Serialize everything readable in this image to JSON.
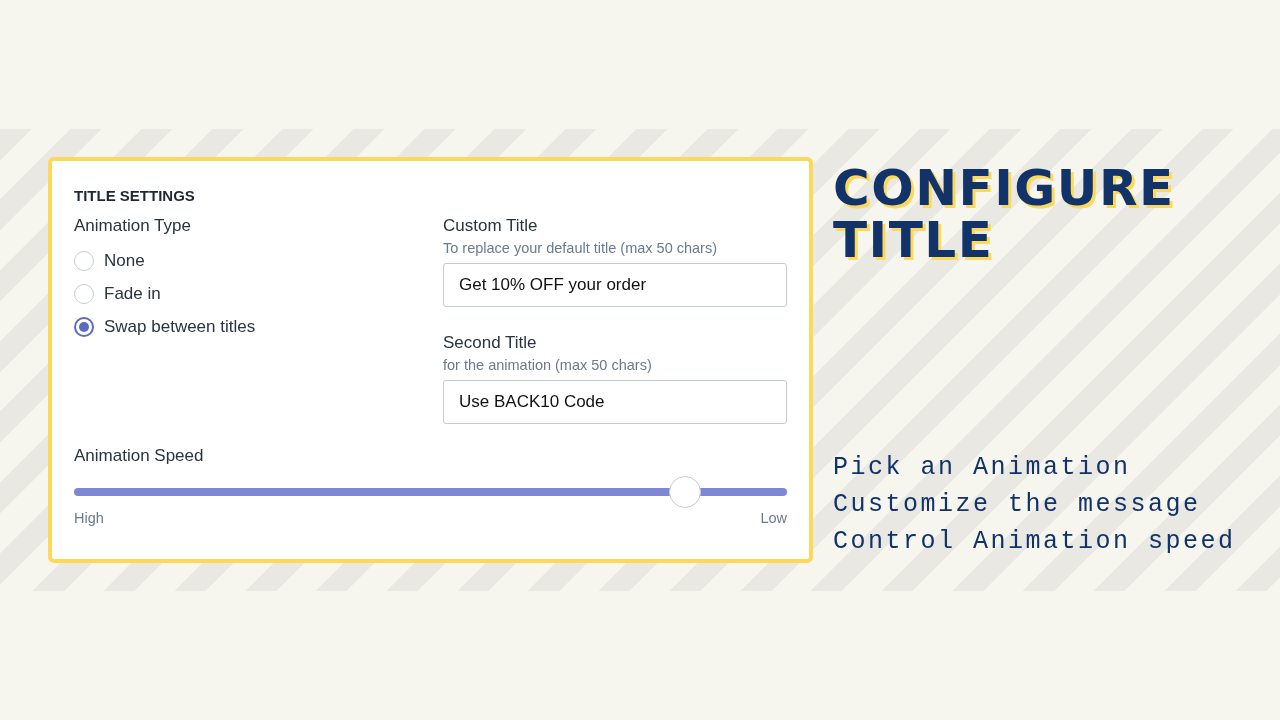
{
  "panel": {
    "heading": "TITLE SETTINGS",
    "animation_type": {
      "label": "Animation Type",
      "options": [
        {
          "label": "None",
          "selected": false
        },
        {
          "label": "Fade in",
          "selected": false
        },
        {
          "label": "Swap between titles",
          "selected": true
        }
      ]
    },
    "custom_title": {
      "label": "Custom Title",
      "hint": "To replace your default title (max 50 chars)",
      "value": "Get 10% OFF your order"
    },
    "second_title": {
      "label": "Second Title",
      "hint": "for the animation (max 50 chars)",
      "value": "Use BACK10 Code"
    },
    "animation_speed": {
      "label": "Animation Speed",
      "level": 0.857,
      "min_label": "High",
      "max_label": "Low"
    }
  },
  "promo": {
    "title_lines": [
      "CONFIGURE",
      "TITLE"
    ],
    "features": [
      "Pick an Animation",
      "Customize the message",
      "Control Animation speed"
    ]
  }
}
